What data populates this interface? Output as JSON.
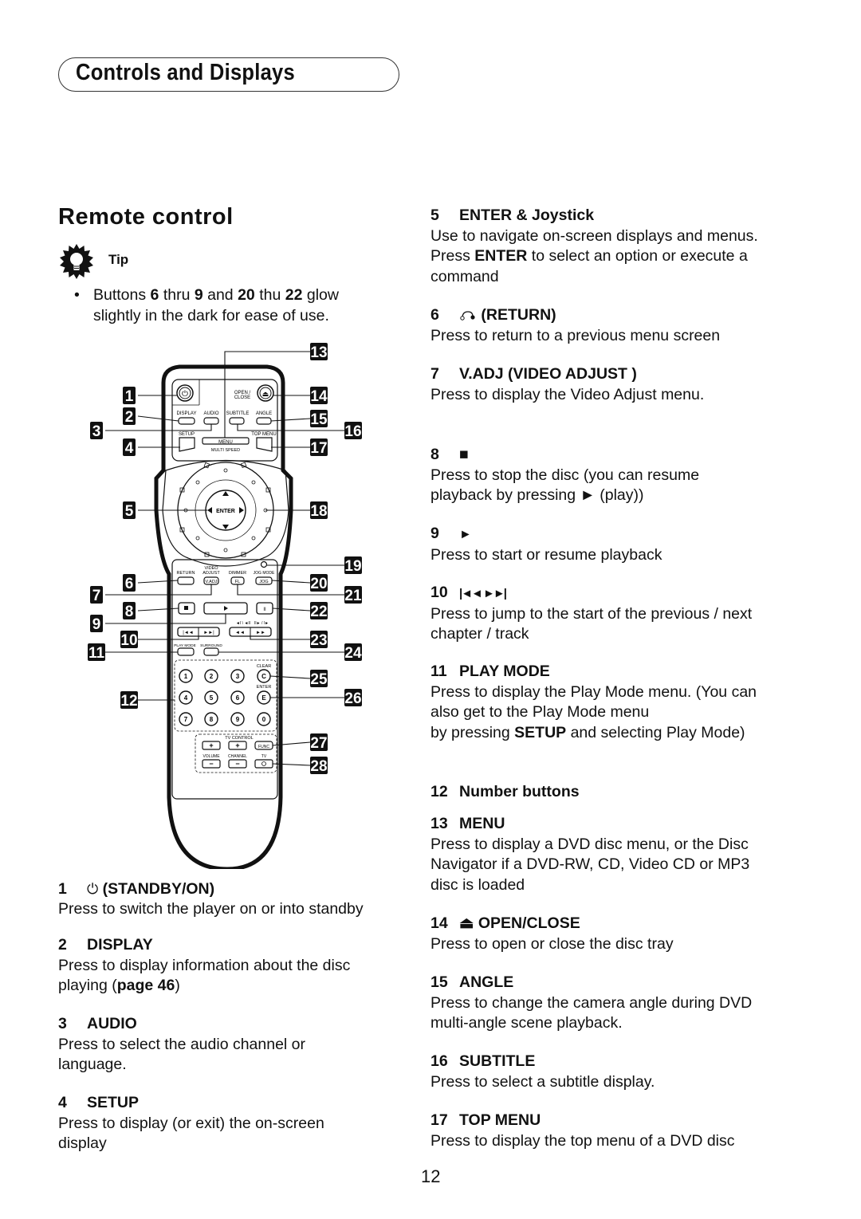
{
  "section_header": "Controls and Displays",
  "page_title": "Remote control",
  "tip": {
    "icon": "lightbulb-icon",
    "label": "Tip",
    "bullet": "Buttons 6 thru 9 and 20 thu 22 glow slightly in the dark for ease of use.",
    "bullet_parts": [
      "Buttons ",
      "6",
      " thru ",
      "9",
      " and ",
      "20",
      " thu ",
      "22",
      " glow slightly in the dark for ease of use."
    ]
  },
  "remote": {
    "labels": {
      "open_close": "OPEN / CLOSE",
      "display": "DISPLAY",
      "audio": "AUDIO",
      "subtitle": "SUBTITLE",
      "angle": "ANGLE",
      "setup": "SETUP",
      "menu": "MENU",
      "top_menu": "TOP MENU",
      "multi_speed": "MULTI SPEED",
      "enter": "ENTER",
      "return": "RETURN",
      "video_adjust": "VIDEO ADJUST",
      "dimmer": "DIMMER",
      "jog_mode": "JOG MODE",
      "vadj": "V.ADJ",
      "fl": "FL",
      "jog": "JOG",
      "play_mode": "PLAY MODE",
      "surround": "SURROUND",
      "clear": "CLEAR",
      "enter_small": "ENTER",
      "c": "C",
      "e": "E",
      "tv_control": "TV CONTROL",
      "volume": "VOLUME",
      "channel": "CHANNEL",
      "func": "FUNC",
      "tv": "TV"
    },
    "number_keys": [
      "1",
      "2",
      "3",
      "4",
      "5",
      "6",
      "7",
      "8",
      "9",
      "0"
    ],
    "callouts": [
      "1",
      "2",
      "3",
      "4",
      "5",
      "6",
      "7",
      "8",
      "9",
      "10",
      "11",
      "12",
      "13",
      "14",
      "15",
      "16",
      "17",
      "18",
      "19",
      "20",
      "21",
      "22",
      "23",
      "24",
      "25",
      "26",
      "27",
      "28"
    ]
  },
  "left_entries": [
    {
      "num": "1",
      "symbol": "⏻",
      "title": "(STANDBY/ON)",
      "desc": "Press to switch the player on or into standby"
    },
    {
      "num": "2",
      "symbol": "",
      "title": "DISPLAY",
      "desc": "Press to display information about the disc playing (",
      "desc_bold": "page 46",
      "desc_tail": ")"
    },
    {
      "num": "3",
      "symbol": "",
      "title": "AUDIO",
      "desc": "Press to select the audio channel or language."
    },
    {
      "num": "4",
      "symbol": "",
      "title": "SETUP",
      "desc": "Press to display (or exit) the on-screen display"
    }
  ],
  "right_entries": [
    {
      "num": "5",
      "symbol": "",
      "title": "ENTER & Joystick",
      "desc_pre": "Use to navigate on-screen displays and menus. Press ",
      "desc_bold": "ENTER",
      "desc": " to select an option or execute a command"
    },
    {
      "num": "6",
      "symbol": "return-icon",
      "title": "(RETURN)",
      "desc": "Press to return to a previous menu screen"
    },
    {
      "num": "7",
      "symbol": "",
      "title": "V.ADJ (VIDEO ADJUST )",
      "desc": "Press to display the Video Adjust menu."
    },
    {
      "num": "8",
      "symbol": "■",
      "title": "",
      "desc": "Press to stop the disc (you can resume playback by pressing ► (play))"
    },
    {
      "num": "9",
      "symbol": "►",
      "title": "",
      "desc": "Press to start or resume playback"
    },
    {
      "num": "10",
      "symbol": "|◄◄ ►►|",
      "title": "",
      "desc": "Press to jump to the start of the previous / next chapter / track"
    },
    {
      "num": "11",
      "symbol": "",
      "title": "PLAY MODE",
      "desc": "Press to display the Play Mode menu. (You can also get to the Play Mode menu",
      "desc2_pre": " by pressing ",
      "desc2_bold": "SETUP",
      "desc2_tail": " and selecting Play Mode)"
    },
    {
      "num": "12",
      "symbol": "",
      "title": "Number buttons",
      "desc": ""
    },
    {
      "num": "13",
      "symbol": "",
      "title": "MENU",
      "desc": "Press to display a DVD disc menu, or the Disc Navigator if a DVD-RW, CD, Video CD or MP3 disc is loaded"
    },
    {
      "num": "14",
      "symbol": "⏏",
      "title": "OPEN/CLOSE",
      "desc": "Press to open or close the disc tray"
    },
    {
      "num": "15",
      "symbol": "",
      "title": "ANGLE",
      "desc": "Press to change the camera angle during DVD multi-angle scene playback."
    },
    {
      "num": "16",
      "symbol": "",
      "title": "SUBTITLE",
      "desc": "Press to select a subtitle display."
    },
    {
      "num": "17",
      "symbol": "",
      "title": "TOP MENU",
      "desc": "Press to display the top menu of a DVD disc"
    }
  ],
  "page_number": "12"
}
